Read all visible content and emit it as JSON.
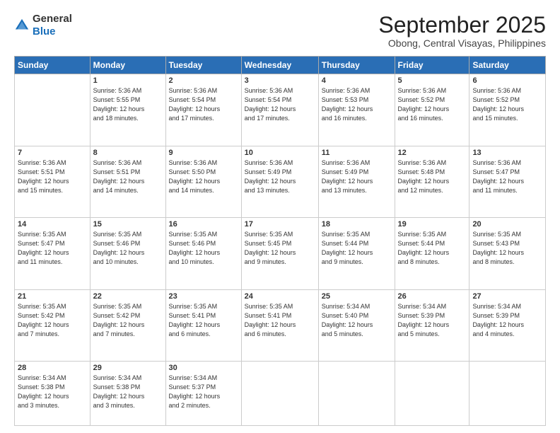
{
  "header": {
    "logo_general": "General",
    "logo_blue": "Blue",
    "month_title": "September 2025",
    "location": "Obong, Central Visayas, Philippines"
  },
  "days_of_week": [
    "Sunday",
    "Monday",
    "Tuesday",
    "Wednesday",
    "Thursday",
    "Friday",
    "Saturday"
  ],
  "weeks": [
    [
      {
        "day": "",
        "content": ""
      },
      {
        "day": "1",
        "content": "Sunrise: 5:36 AM\nSunset: 5:55 PM\nDaylight: 12 hours\nand 18 minutes."
      },
      {
        "day": "2",
        "content": "Sunrise: 5:36 AM\nSunset: 5:54 PM\nDaylight: 12 hours\nand 17 minutes."
      },
      {
        "day": "3",
        "content": "Sunrise: 5:36 AM\nSunset: 5:54 PM\nDaylight: 12 hours\nand 17 minutes."
      },
      {
        "day": "4",
        "content": "Sunrise: 5:36 AM\nSunset: 5:53 PM\nDaylight: 12 hours\nand 16 minutes."
      },
      {
        "day": "5",
        "content": "Sunrise: 5:36 AM\nSunset: 5:52 PM\nDaylight: 12 hours\nand 16 minutes."
      },
      {
        "day": "6",
        "content": "Sunrise: 5:36 AM\nSunset: 5:52 PM\nDaylight: 12 hours\nand 15 minutes."
      }
    ],
    [
      {
        "day": "7",
        "content": "Sunrise: 5:36 AM\nSunset: 5:51 PM\nDaylight: 12 hours\nand 15 minutes."
      },
      {
        "day": "8",
        "content": "Sunrise: 5:36 AM\nSunset: 5:51 PM\nDaylight: 12 hours\nand 14 minutes."
      },
      {
        "day": "9",
        "content": "Sunrise: 5:36 AM\nSunset: 5:50 PM\nDaylight: 12 hours\nand 14 minutes."
      },
      {
        "day": "10",
        "content": "Sunrise: 5:36 AM\nSunset: 5:49 PM\nDaylight: 12 hours\nand 13 minutes."
      },
      {
        "day": "11",
        "content": "Sunrise: 5:36 AM\nSunset: 5:49 PM\nDaylight: 12 hours\nand 13 minutes."
      },
      {
        "day": "12",
        "content": "Sunrise: 5:36 AM\nSunset: 5:48 PM\nDaylight: 12 hours\nand 12 minutes."
      },
      {
        "day": "13",
        "content": "Sunrise: 5:36 AM\nSunset: 5:47 PM\nDaylight: 12 hours\nand 11 minutes."
      }
    ],
    [
      {
        "day": "14",
        "content": "Sunrise: 5:35 AM\nSunset: 5:47 PM\nDaylight: 12 hours\nand 11 minutes."
      },
      {
        "day": "15",
        "content": "Sunrise: 5:35 AM\nSunset: 5:46 PM\nDaylight: 12 hours\nand 10 minutes."
      },
      {
        "day": "16",
        "content": "Sunrise: 5:35 AM\nSunset: 5:46 PM\nDaylight: 12 hours\nand 10 minutes."
      },
      {
        "day": "17",
        "content": "Sunrise: 5:35 AM\nSunset: 5:45 PM\nDaylight: 12 hours\nand 9 minutes."
      },
      {
        "day": "18",
        "content": "Sunrise: 5:35 AM\nSunset: 5:44 PM\nDaylight: 12 hours\nand 9 minutes."
      },
      {
        "day": "19",
        "content": "Sunrise: 5:35 AM\nSunset: 5:44 PM\nDaylight: 12 hours\nand 8 minutes."
      },
      {
        "day": "20",
        "content": "Sunrise: 5:35 AM\nSunset: 5:43 PM\nDaylight: 12 hours\nand 8 minutes."
      }
    ],
    [
      {
        "day": "21",
        "content": "Sunrise: 5:35 AM\nSunset: 5:42 PM\nDaylight: 12 hours\nand 7 minutes."
      },
      {
        "day": "22",
        "content": "Sunrise: 5:35 AM\nSunset: 5:42 PM\nDaylight: 12 hours\nand 7 minutes."
      },
      {
        "day": "23",
        "content": "Sunrise: 5:35 AM\nSunset: 5:41 PM\nDaylight: 12 hours\nand 6 minutes."
      },
      {
        "day": "24",
        "content": "Sunrise: 5:35 AM\nSunset: 5:41 PM\nDaylight: 12 hours\nand 6 minutes."
      },
      {
        "day": "25",
        "content": "Sunrise: 5:34 AM\nSunset: 5:40 PM\nDaylight: 12 hours\nand 5 minutes."
      },
      {
        "day": "26",
        "content": "Sunrise: 5:34 AM\nSunset: 5:39 PM\nDaylight: 12 hours\nand 5 minutes."
      },
      {
        "day": "27",
        "content": "Sunrise: 5:34 AM\nSunset: 5:39 PM\nDaylight: 12 hours\nand 4 minutes."
      }
    ],
    [
      {
        "day": "28",
        "content": "Sunrise: 5:34 AM\nSunset: 5:38 PM\nDaylight: 12 hours\nand 3 minutes."
      },
      {
        "day": "29",
        "content": "Sunrise: 5:34 AM\nSunset: 5:38 PM\nDaylight: 12 hours\nand 3 minutes."
      },
      {
        "day": "30",
        "content": "Sunrise: 5:34 AM\nSunset: 5:37 PM\nDaylight: 12 hours\nand 2 minutes."
      },
      {
        "day": "",
        "content": ""
      },
      {
        "day": "",
        "content": ""
      },
      {
        "day": "",
        "content": ""
      },
      {
        "day": "",
        "content": ""
      }
    ]
  ]
}
